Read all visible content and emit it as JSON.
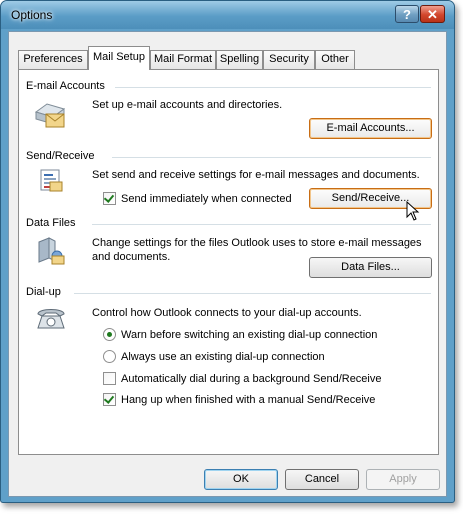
{
  "window": {
    "title": "Options"
  },
  "tabs": [
    {
      "label": "Preferences"
    },
    {
      "label": "Mail Setup"
    },
    {
      "label": "Mail Format"
    },
    {
      "label": "Spelling"
    },
    {
      "label": "Security"
    },
    {
      "label": "Other"
    }
  ],
  "email_accounts": {
    "title": "E-mail Accounts",
    "description": "Set up e-mail accounts and directories.",
    "button": "E-mail Accounts..."
  },
  "send_receive": {
    "title": "Send/Receive",
    "description": "Set send and receive settings for e-mail messages and documents.",
    "checkbox_label": "Send immediately when connected",
    "checkbox_checked": true,
    "button": "Send/Receive..."
  },
  "data_files": {
    "title": "Data Files",
    "description_line1": "Change settings for the files Outlook uses to store e-mail messages",
    "description_line2": "and documents.",
    "button": "Data Files..."
  },
  "dialup": {
    "title": "Dial-up",
    "description": "Control how Outlook connects to your dial-up accounts.",
    "radio1": "Warn before switching an existing dial-up connection",
    "radio2": "Always use an existing dial-up connection",
    "check1": "Automatically dial during a background Send/Receive",
    "check2": "Hang up when finished with a manual Send/Receive",
    "selected_radio": 1,
    "check1_checked": false,
    "check2_checked": true
  },
  "footer": {
    "ok": "OK",
    "cancel": "Cancel",
    "apply": "Apply"
  }
}
